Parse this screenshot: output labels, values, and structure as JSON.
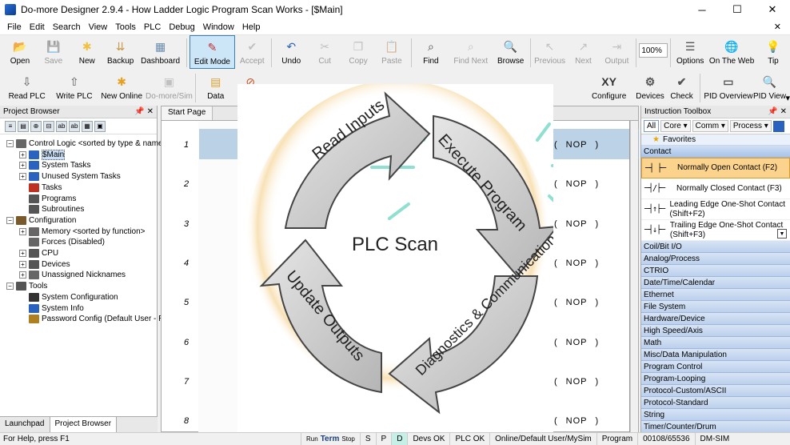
{
  "window": {
    "title": "Do-more Designer 2.9.4 - How Ladder Logic Program Scan Works - [$Main]"
  },
  "menu": [
    "File",
    "Edit",
    "Search",
    "View",
    "Tools",
    "PLC",
    "Debug",
    "Window",
    "Help"
  ],
  "menu_close": "✕",
  "toolbar1": [
    {
      "label": "Open",
      "icon": "open-folder-icon",
      "disabled": false,
      "color": "#e8b84a",
      "glyph": "📂"
    },
    {
      "label": "Save",
      "icon": "save-icon",
      "disabled": true,
      "color": "#6b8fc2",
      "glyph": "💾"
    },
    {
      "label": "New",
      "icon": "new-icon",
      "disabled": false,
      "color": "#f0c040",
      "glyph": "✱"
    },
    {
      "label": "Backup",
      "icon": "backup-icon",
      "disabled": false,
      "color": "#c89a4a",
      "glyph": "⇊"
    },
    {
      "label": "Dashboard",
      "icon": "dashboard-icon",
      "disabled": false,
      "color": "#6c8db0",
      "glyph": "▦"
    },
    {
      "label": "Edit Mode",
      "icon": "edit-mode-icon",
      "disabled": false,
      "active": true,
      "color": "#c03030",
      "glyph": "✎"
    },
    {
      "label": "Accept",
      "icon": "accept-icon",
      "disabled": true,
      "color": "#888",
      "glyph": "✔"
    },
    {
      "label": "Undo",
      "icon": "undo-icon",
      "disabled": false,
      "color": "#2a62c0",
      "glyph": "↶"
    },
    {
      "label": "Cut",
      "icon": "cut-icon",
      "disabled": true,
      "color": "#888",
      "glyph": "✂"
    },
    {
      "label": "Copy",
      "icon": "copy-icon",
      "disabled": true,
      "color": "#888",
      "glyph": "❐"
    },
    {
      "label": "Paste",
      "icon": "paste-icon",
      "disabled": true,
      "color": "#888",
      "glyph": "📋"
    },
    {
      "label": "Find",
      "icon": "binoculars-icon",
      "disabled": false,
      "color": "#444",
      "glyph": "⌕"
    },
    {
      "label": "Find Next",
      "icon": "find-next-icon",
      "disabled": true,
      "color": "#888",
      "glyph": "⌕"
    },
    {
      "label": "Browse",
      "icon": "browse-icon",
      "disabled": false,
      "color": "#2a62c0",
      "glyph": "🔍"
    },
    {
      "label": "Previous",
      "icon": "previous-icon",
      "disabled": true,
      "color": "#888",
      "glyph": "↖"
    },
    {
      "label": "Next",
      "icon": "next-icon",
      "disabled": true,
      "color": "#888",
      "glyph": "↗"
    },
    {
      "label": "Output",
      "icon": "output-icon",
      "disabled": true,
      "color": "#888",
      "glyph": "⇥"
    }
  ],
  "zoom": "100%",
  "toolbar1b": [
    {
      "label": "Options",
      "icon": "options-icon",
      "disabled": false,
      "color": "#555",
      "glyph": "☰"
    },
    {
      "label": "On The Web",
      "icon": "globe-icon",
      "disabled": false,
      "color": "#2a6fd6",
      "glyph": "🌐"
    },
    {
      "label": "Tip",
      "icon": "tip-icon",
      "disabled": false,
      "color": "#e6b800",
      "glyph": "💡"
    }
  ],
  "toolbar2": [
    {
      "label": "Read PLC",
      "icon": "read-plc-icon",
      "disabled": false,
      "color": "#555",
      "glyph": "⇩"
    },
    {
      "label": "Write PLC",
      "icon": "write-plc-icon",
      "disabled": false,
      "color": "#555",
      "glyph": "⇧"
    },
    {
      "label": "New Online",
      "icon": "new-online-icon",
      "disabled": false,
      "color": "#e8a020",
      "glyph": "✱"
    },
    {
      "label": "Do-more/Sim",
      "icon": "sim-icon",
      "disabled": true,
      "color": "#888",
      "glyph": "▣"
    },
    {
      "label": "Data",
      "icon": "data-icon",
      "disabled": false,
      "color": "#e0a030",
      "glyph": "▤"
    },
    {
      "label": "Debug",
      "icon": "debug-icon",
      "disabled": false,
      "color": "#c05020",
      "glyph": "⊘"
    }
  ],
  "toolbar2b": [
    {
      "label": "Configure",
      "icon": "configure-icon",
      "disabled": false,
      "color": "#333",
      "glyph": "XY"
    },
    {
      "label": "Devices",
      "icon": "devices-icon",
      "disabled": false,
      "color": "#555",
      "glyph": "⚙"
    },
    {
      "label": "Check",
      "icon": "check-icon",
      "disabled": false,
      "color": "#555",
      "glyph": "✔"
    },
    {
      "label": "PID Overview",
      "icon": "pid-overview-icon",
      "disabled": false,
      "color": "#555",
      "glyph": "▭"
    },
    {
      "label": "PID View",
      "icon": "pid-view-icon",
      "disabled": false,
      "color": "#2a62c0",
      "glyph": "🔍"
    }
  ],
  "pid_view_suffix": "▾",
  "project_browser": {
    "title": "Project Browser",
    "pin": "📌 ✕",
    "tool_icons": [
      "≡",
      "▤",
      "⊕",
      "⊟",
      "ab",
      "ab",
      "▦",
      "▣"
    ],
    "nodes": [
      {
        "label": "Control Logic <sorted by type & name>",
        "level": 0,
        "exp": "−",
        "icon": "#666",
        "sel": false
      },
      {
        "label": "$Main",
        "level": 1,
        "exp": "+",
        "icon": "#2a62c0",
        "sel": true
      },
      {
        "label": "System Tasks",
        "level": 1,
        "exp": "+",
        "icon": "#2a62c0",
        "sel": false
      },
      {
        "label": "Unused System Tasks",
        "level": 1,
        "exp": "+",
        "icon": "#2a62c0",
        "sel": false
      },
      {
        "label": "Tasks",
        "level": 1,
        "exp": "",
        "icon": "#c03020",
        "sel": false
      },
      {
        "label": "Programs",
        "level": 1,
        "exp": "",
        "icon": "#555",
        "sel": false
      },
      {
        "label": "Subroutines",
        "level": 1,
        "exp": "",
        "icon": "#555",
        "sel": false
      },
      {
        "label": "Configuration",
        "level": 0,
        "exp": "−",
        "icon": "#7a5a2a",
        "sel": false
      },
      {
        "label": "Memory <sorted by function>",
        "level": 1,
        "exp": "+",
        "icon": "#666",
        "sel": false
      },
      {
        "label": "Forces (Disabled)",
        "level": 1,
        "exp": "",
        "icon": "#666",
        "sel": false
      },
      {
        "label": "CPU",
        "level": 1,
        "exp": "+",
        "icon": "#555",
        "sel": false
      },
      {
        "label": "Devices",
        "level": 1,
        "exp": "+",
        "icon": "#555",
        "sel": false
      },
      {
        "label": "Unassigned Nicknames",
        "level": 1,
        "exp": "+",
        "icon": "#666",
        "sel": false
      },
      {
        "label": "Tools",
        "level": 0,
        "exp": "−",
        "icon": "#555",
        "sel": false
      },
      {
        "label": "System Configuration",
        "level": 1,
        "exp": "",
        "icon": "#333",
        "sel": false
      },
      {
        "label": "System Info",
        "level": 1,
        "exp": "",
        "icon": "#2a62c0",
        "sel": false
      },
      {
        "label": "Password Config (Default User - R",
        "level": 1,
        "exp": "",
        "icon": "#b08020",
        "sel": false
      }
    ],
    "bottom_tabs": [
      "Launchpad",
      "Project Browser"
    ]
  },
  "editor": {
    "tabs": [
      "Start Page"
    ],
    "rungs": [
      "1",
      "2",
      "3",
      "4",
      "5",
      "6",
      "7",
      "8"
    ],
    "coil_label": "NOP",
    "coil_open": "(",
    "coil_close": ")"
  },
  "diagram": {
    "title": "PLC Scan",
    "steps": [
      "Read Inputs",
      "Execute Program",
      "Diagnostics & Communication",
      "Update Outputs"
    ],
    "arrow_color": "#c8c8c8"
  },
  "toolbox": {
    "title": "Instruction Toolbox",
    "pin": "📌 ✕",
    "tabs": [
      "All",
      "Core ▾",
      "Comm ▾",
      "Process ▾"
    ],
    "favorites": "Favorites",
    "open_category": "Contact",
    "contacts": [
      {
        "symbol": "─┤ ├─",
        "label": "Normally Open Contact (F2)",
        "sel": true
      },
      {
        "symbol": "─┤/├─",
        "label": "Normally Closed Contact (F3)",
        "sel": false
      },
      {
        "symbol": "─┤↑├─",
        "label": "Leading Edge One-Shot Contact (Shift+F2)",
        "sel": false
      },
      {
        "symbol": "─┤↓├─",
        "label": "Trailing Edge One-Shot Contact (Shift+F3)",
        "sel": false
      }
    ],
    "categories": [
      "Coil/Bit I/O",
      "Analog/Process",
      "CTRIO",
      "Date/Time/Calendar",
      "Ethernet",
      "File System",
      "Hardware/Device",
      "High Speed/Axis",
      "Math",
      "Misc/Data Manipulation",
      "Program Control",
      "Program-Looping",
      "Protocol-Custom/ASCII",
      "Protocol-Standard",
      "String",
      "Timer/Counter/Drum"
    ]
  },
  "status": {
    "help": "For Help, press F1",
    "run": "Run",
    "term": "Term",
    "stop": "Stop",
    "s": "S",
    "p": "P",
    "d": "D",
    "devs": "Devs OK",
    "plc": "PLC OK",
    "user": "Online/Default User/MySim",
    "mode": "Program",
    "mem": "00108/65536",
    "sim": "DM-SIM"
  }
}
